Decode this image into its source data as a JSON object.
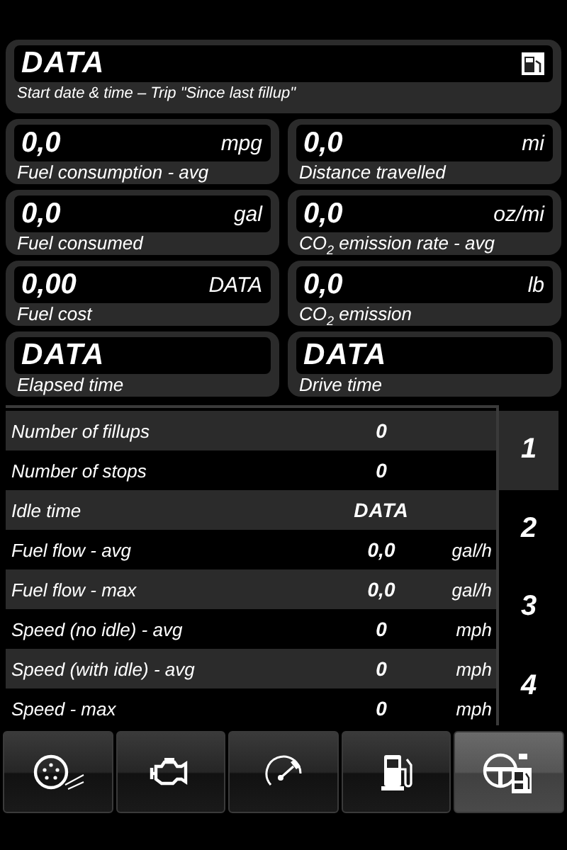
{
  "header": {
    "value": "DATA",
    "caption": "Start date & time – Trip \"Since last fillup\""
  },
  "cards": [
    {
      "value": "0,0",
      "unit": "mpg",
      "label": "Fuel consumption - avg"
    },
    {
      "value": "0,0",
      "unit": "mi",
      "label": "Distance travelled"
    },
    {
      "value": "0,0",
      "unit": "gal",
      "label": "Fuel consumed"
    },
    {
      "value": "0,0",
      "unit": "oz/mi",
      "label": "CO$_{2}$ emission rate - avg"
    },
    {
      "value": "0,00",
      "unit": "DATA",
      "label": "Fuel cost"
    },
    {
      "value": "0,0",
      "unit": "lb",
      "label": "CO$_{2}$ emission"
    },
    {
      "value": "DATA",
      "label": "Elapsed time"
    },
    {
      "value": "DATA",
      "label": "Drive time"
    }
  ],
  "table": {
    "rows": [
      {
        "label": "Number of fillups",
        "value": "0"
      },
      {
        "label": "Number of stops",
        "value": "0"
      },
      {
        "label": "Idle time",
        "value": "DATA"
      },
      {
        "label": "Fuel flow - avg",
        "value": "0,0",
        "unit": "gal/h"
      },
      {
        "label": "Fuel flow - max",
        "value": "0,0",
        "unit": "gal/h"
      },
      {
        "label": "Speed (no idle) - avg",
        "value": "0",
        "unit": "mph"
      },
      {
        "label": "Speed (with idle) - avg",
        "value": "0",
        "unit": "mph"
      },
      {
        "label": "Speed - max",
        "value": "0",
        "unit": "mph"
      }
    ]
  },
  "pages": [
    {
      "label": "1",
      "selected": true
    },
    {
      "label": "2",
      "selected": false
    },
    {
      "label": "3",
      "selected": false
    },
    {
      "label": "4",
      "selected": false
    }
  ],
  "tabs": [
    {
      "kind": "tire",
      "selected": false
    },
    {
      "kind": "engine",
      "selected": false
    },
    {
      "kind": "gauge",
      "selected": false
    },
    {
      "kind": "fuel",
      "selected": false
    },
    {
      "kind": "wheel",
      "selected": true
    }
  ]
}
